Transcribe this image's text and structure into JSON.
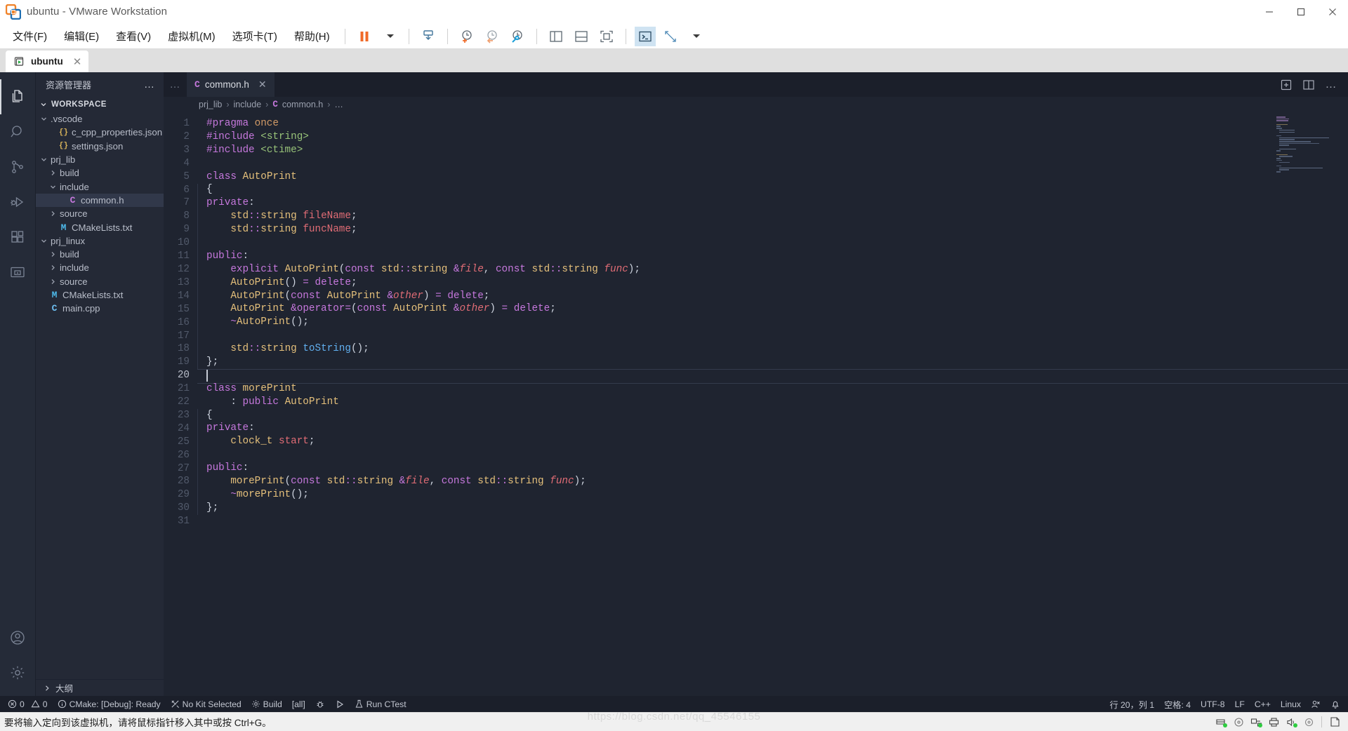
{
  "window": {
    "title": "ubuntu - VMware Workstation",
    "app_icon": "vmware-icon",
    "minimize_label": "—",
    "maximize_label": "❐",
    "close_label": "✕"
  },
  "menubar": {
    "items": [
      {
        "label": "文件(F)",
        "name": "menu-file"
      },
      {
        "label": "编辑(E)",
        "name": "menu-edit"
      },
      {
        "label": "查看(V)",
        "name": "menu-view"
      },
      {
        "label": "虚拟机(M)",
        "name": "menu-vm"
      },
      {
        "label": "选项卡(T)",
        "name": "menu-tabs"
      },
      {
        "label": "帮助(H)",
        "name": "menu-help"
      }
    ],
    "toolbar_icons": [
      "pause-icon",
      "dropdown-caret-icon",
      "snapshot-manager-icon",
      "take-snapshot-icon",
      "revert-snapshot-icon",
      "manage-snapshots-icon",
      "show-sidebar-icon",
      "show-console-icon",
      "fullscreen-icon",
      "unity-icon",
      "stretch-caret-icon"
    ]
  },
  "vm_tabs": [
    {
      "label": "ubuntu",
      "icon": "vm-play-icon",
      "close": "✕",
      "active": true
    }
  ],
  "activitybar": {
    "items": [
      {
        "name": "explorer",
        "icon": "files-icon",
        "active": true
      },
      {
        "name": "search",
        "icon": "search-icon",
        "active": false
      },
      {
        "name": "source-control",
        "icon": "source-control-icon",
        "active": false
      },
      {
        "name": "run-debug",
        "icon": "run-debug-icon",
        "active": false
      },
      {
        "name": "extensions",
        "icon": "extensions-icon",
        "active": false
      },
      {
        "name": "remote-explorer",
        "icon": "remote-explorer-icon",
        "active": false
      }
    ],
    "bottom": [
      {
        "name": "accounts",
        "icon": "account-icon"
      },
      {
        "name": "settings",
        "icon": "gear-icon"
      }
    ]
  },
  "sidebar": {
    "title": "资源管理器",
    "more_actions": "…",
    "section": "WORKSPACE",
    "outline_label": "大纲",
    "tree": [
      {
        "label": ".vscode",
        "depth": 1,
        "type": "folder",
        "expanded": true,
        "icon": "chevron-down-icon"
      },
      {
        "label": "c_cpp_properties.json",
        "depth": 2,
        "type": "json",
        "icon": "json-icon"
      },
      {
        "label": "settings.json",
        "depth": 2,
        "type": "json",
        "icon": "json-icon"
      },
      {
        "label": "prj_lib",
        "depth": 1,
        "type": "folder",
        "expanded": true,
        "icon": "chevron-down-icon"
      },
      {
        "label": "build",
        "depth": 2,
        "type": "folder",
        "expanded": false,
        "icon": "chevron-right-icon"
      },
      {
        "label": "include",
        "depth": 2,
        "type": "folder",
        "expanded": true,
        "icon": "chevron-down-icon"
      },
      {
        "label": "common.h",
        "depth": 3,
        "type": "cpp-header",
        "icon": "c-file-icon",
        "selected": true
      },
      {
        "label": "source",
        "depth": 2,
        "type": "folder",
        "expanded": false,
        "icon": "chevron-right-icon"
      },
      {
        "label": "CMakeLists.txt",
        "depth": 2,
        "type": "cmake",
        "icon": "m-file-icon"
      },
      {
        "label": "prj_linux",
        "depth": 1,
        "type": "folder",
        "expanded": true,
        "icon": "chevron-down-icon"
      },
      {
        "label": "build",
        "depth": 2,
        "type": "folder",
        "expanded": false,
        "icon": "chevron-right-icon"
      },
      {
        "label": "include",
        "depth": 2,
        "type": "folder",
        "expanded": false,
        "icon": "chevron-right-icon"
      },
      {
        "label": "source",
        "depth": 2,
        "type": "folder",
        "expanded": false,
        "icon": "chevron-right-icon"
      },
      {
        "label": "CMakeLists.txt",
        "depth": 1,
        "type": "cmake",
        "icon": "m-file-icon"
      },
      {
        "label": "main.cpp",
        "depth": 1,
        "type": "cpp",
        "icon": "cpp-file-icon"
      }
    ]
  },
  "editor": {
    "more_tabs": "…",
    "tab": {
      "label": "common.h",
      "icon": "C",
      "close": "✕"
    },
    "actions": [
      "split-editor-right-icon",
      "open-changes-icon",
      "more-actions-icon"
    ],
    "breadcrumb": [
      "prj_lib",
      "include",
      "common.h",
      "…"
    ],
    "breadcrumb_separator": "›",
    "cursor_line": 20,
    "total_lines": 31,
    "lines": [
      {
        "n": 1,
        "text": "#pragma once"
      },
      {
        "n": 2,
        "text": "#include <string>"
      },
      {
        "n": 3,
        "text": "#include <ctime>"
      },
      {
        "n": 4,
        "text": ""
      },
      {
        "n": 5,
        "text": "class AutoPrint"
      },
      {
        "n": 6,
        "text": "{"
      },
      {
        "n": 7,
        "text": "private:"
      },
      {
        "n": 8,
        "text": "    std::string fileName;"
      },
      {
        "n": 9,
        "text": "    std::string funcName;"
      },
      {
        "n": 10,
        "text": ""
      },
      {
        "n": 11,
        "text": "public:"
      },
      {
        "n": 12,
        "text": "    explicit AutoPrint(const std::string &file, const std::string func);"
      },
      {
        "n": 13,
        "text": "    AutoPrint() = delete;"
      },
      {
        "n": 14,
        "text": "    AutoPrint(const AutoPrint &other) = delete;"
      },
      {
        "n": 15,
        "text": "    AutoPrint &operator=(const AutoPrint &other) = delete;"
      },
      {
        "n": 16,
        "text": "    ~AutoPrint();"
      },
      {
        "n": 17,
        "text": ""
      },
      {
        "n": 18,
        "text": "    std::string toString();"
      },
      {
        "n": 19,
        "text": "};"
      },
      {
        "n": 20,
        "text": ""
      },
      {
        "n": 21,
        "text": "class morePrint"
      },
      {
        "n": 22,
        "text": "    : public AutoPrint"
      },
      {
        "n": 23,
        "text": "{"
      },
      {
        "n": 24,
        "text": "private:"
      },
      {
        "n": 25,
        "text": "    clock_t start;"
      },
      {
        "n": 26,
        "text": ""
      },
      {
        "n": 27,
        "text": "public:"
      },
      {
        "n": 28,
        "text": "    morePrint(const std::string &file, const std::string func);"
      },
      {
        "n": 29,
        "text": "    ~morePrint();"
      },
      {
        "n": 30,
        "text": "};"
      },
      {
        "n": 31,
        "text": ""
      }
    ]
  },
  "statusbar": {
    "left": [
      {
        "name": "problems",
        "icon": "error-icon",
        "label": "0",
        "icon2": "warning-icon",
        "label2": "0"
      },
      {
        "name": "cmake-status",
        "icon": "info-icon",
        "label": "CMake: [Debug]: Ready"
      },
      {
        "name": "kit-selector",
        "icon": "tools-icon",
        "label": "No Kit Selected"
      },
      {
        "name": "build-button",
        "icon": "gear-icon",
        "label": "Build"
      },
      {
        "name": "build-target",
        "icon": "",
        "label": "[all]"
      },
      {
        "name": "debug-button",
        "icon": "bug-icon",
        "label": ""
      },
      {
        "name": "launch-button",
        "icon": "play-icon",
        "label": ""
      },
      {
        "name": "run-ctest",
        "icon": "beaker-icon",
        "label": "Run CTest"
      }
    ],
    "right": [
      {
        "name": "cursor-position",
        "label": "行 20，列 1"
      },
      {
        "name": "indentation",
        "label": "空格: 4"
      },
      {
        "name": "encoding",
        "label": "UTF-8"
      },
      {
        "name": "eol",
        "label": "LF"
      },
      {
        "name": "language-mode",
        "label": "C++"
      },
      {
        "name": "remote-host",
        "label": "Linux"
      },
      {
        "name": "feedback",
        "label": "",
        "icon": "feedback-icon"
      },
      {
        "name": "notifications",
        "label": "",
        "icon": "bell-icon"
      }
    ]
  },
  "hostbar": {
    "message": "要将输入定向到该虚拟机，请将鼠标指针移入其中或按 Ctrl+G。",
    "watermark": "https://blog.csdn.net/qq_45546155",
    "tray_icons": [
      "hard-disk-icon",
      "cd-drive-icon",
      "network-icon",
      "printer-icon",
      "sound-icon",
      "floppy-icon",
      "usb-icon"
    ]
  },
  "colors": {
    "accent": "#f06a28",
    "editor_bg": "#1f2430",
    "sidebar_bg": "#242936",
    "activitybar_bg": "#252b38",
    "keyword": "#c678dd",
    "string": "#98c379",
    "type": "#e5c07b",
    "function": "#61afef",
    "variable": "#e06c75",
    "param": "#d19a66",
    "comment": "#5c6370"
  }
}
